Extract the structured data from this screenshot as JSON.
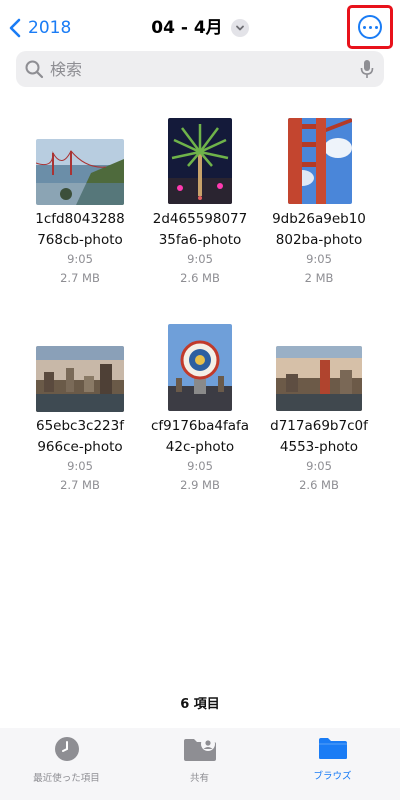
{
  "nav": {
    "back_label": "2018",
    "title": "04 - 4月"
  },
  "search": {
    "placeholder": "検索"
  },
  "files": [
    {
      "name_line1": "1cfd8043288",
      "name_line2": "768cb-photo",
      "time": "9:05",
      "size": "2.7 MB"
    },
    {
      "name_line1": "2d465598077",
      "name_line2": "35fa6-photo",
      "time": "9:05",
      "size": "2.6 MB"
    },
    {
      "name_line1": "9db26a9eb10",
      "name_line2": "802ba-photo",
      "time": "9:05",
      "size": "2 MB"
    },
    {
      "name_line1": "65ebc3c223f",
      "name_line2": "966ce-photo",
      "time": "9:05",
      "size": "2.7 MB"
    },
    {
      "name_line1": "cf9176ba4fafa",
      "name_line2": "42c-photo",
      "time": "9:05",
      "size": "2.9 MB"
    },
    {
      "name_line1": "d717a69b7c0f",
      "name_line2": "4553-photo",
      "time": "9:05",
      "size": "2.6 MB"
    }
  ],
  "footer": {
    "item_count": "6 項目"
  },
  "tabbar": {
    "recents_label": "最近使った項目",
    "shared_label": "共有",
    "browse_label": "ブラウズ"
  },
  "colors": {
    "accent": "#1a7cf5",
    "highlight_box": "#e8121b"
  },
  "icons": [
    "chevron-left-icon",
    "chevron-down-icon",
    "more-icon",
    "search-icon",
    "microphone-icon",
    "clock-icon",
    "shared-folder-icon",
    "folder-icon"
  ]
}
